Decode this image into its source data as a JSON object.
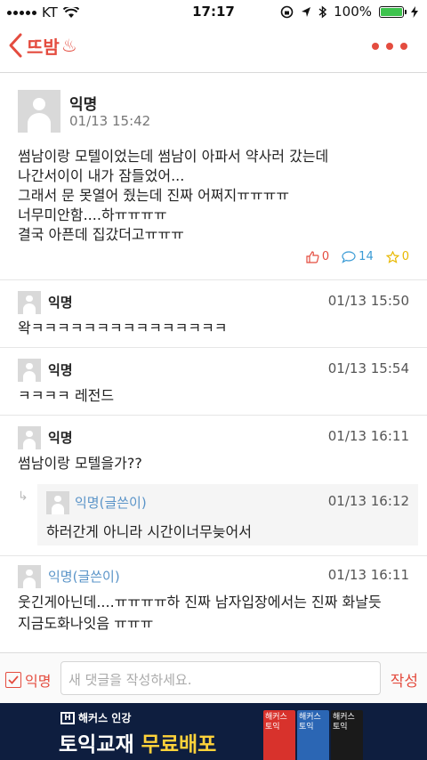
{
  "status_bar": {
    "carrier": "KT",
    "time": "17:17",
    "battery": "100%"
  },
  "nav": {
    "board_name": "뜨밤",
    "board_emoji": "♨"
  },
  "post": {
    "author": "익명",
    "date": "01/13 15:42",
    "lines": [
      "썸남이랑 모텔이었는데 썸남이 아파서 약사러 갔는데",
      "나간서이이 내가 잠들었어...",
      "그래서 문 못열어 줬는데 진짜 어쩌지ㅠㅠㅠㅠ",
      "너무미안함....하ㅠㅠㅠㅠ",
      "결국 아픈데 집갔더고ㅠㅠㅠ"
    ],
    "likes": "0",
    "comments": "14",
    "scraps": "0"
  },
  "comments": [
    {
      "author": "익명",
      "date": "01/13 15:50",
      "text": "왁ㅋㅋㅋㅋㅋㅋㅋㅋㅋㅋㅋㅋㅋㅋㅋ"
    },
    {
      "author": "익명",
      "date": "01/13 15:54",
      "text": "ㅋㅋㅋㅋ 레전드"
    },
    {
      "author": "익명",
      "date": "01/13 16:11",
      "text": "썸남이랑 모텔을가??"
    },
    {
      "author": "익명(글쓴이)",
      "date": "01/13 16:11",
      "text_lines": [
        "웃긴게아닌데....ㅠㅠㅠㅠ하 진짜 남자입장에서는 진짜 화날듯",
        "지금도화나잇음 ㅠㅠㅠ"
      ]
    }
  ],
  "reply": {
    "author": "익명(글쓴이)",
    "date": "01/13 16:12",
    "text": "하러간게 아니라 시간이너무늦어서"
  },
  "composer": {
    "anon_label": "익명",
    "placeholder": "새 댓글을 작성하세요.",
    "submit": "작성"
  },
  "ad": {
    "brand": "해커스 인강",
    "headline_white": "토익교재",
    "headline_yellow": "무료배포",
    "book_labels": [
      "해커스 토익",
      "해커스 토익",
      "해커스 토익"
    ]
  },
  "colors": {
    "accent": "#e44c3f",
    "op": "#5a94c8",
    "ad_bg": "#0e1e3f",
    "ad_highlight": "#ffd23a"
  }
}
